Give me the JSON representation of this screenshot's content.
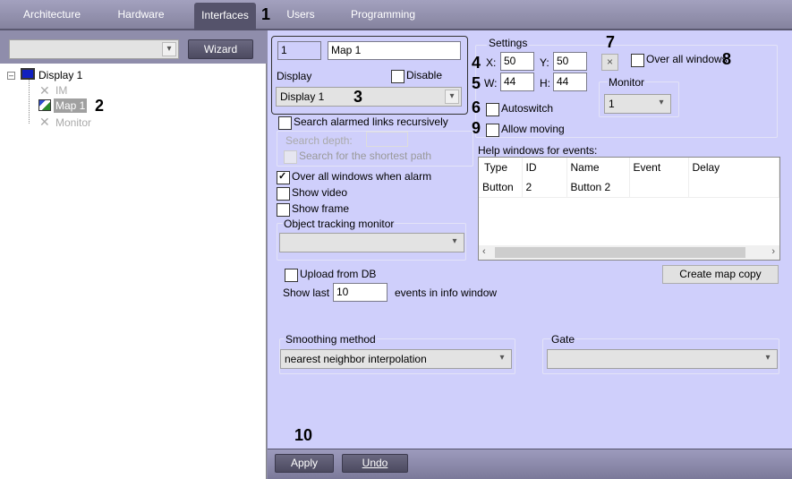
{
  "tabs": [
    {
      "label": "Architecture"
    },
    {
      "label": "Hardware"
    },
    {
      "label": "Interfaces",
      "active": true
    },
    {
      "label": "Users"
    },
    {
      "label": "Programming"
    }
  ],
  "callouts": [
    "1",
    "2",
    "3",
    "4",
    "5",
    "6",
    "7",
    "8",
    "9",
    "10"
  ],
  "left": {
    "filter_value": "",
    "wizard_label": "Wizard",
    "tree": [
      {
        "label": "Display 1",
        "icon": "monitor-icon"
      },
      {
        "label": "IM",
        "icon": "x-icon",
        "disabled": true
      },
      {
        "label": "Map 1",
        "icon": "map-icon",
        "selected": true
      },
      {
        "label": "Monitor",
        "icon": "x-icon",
        "disabled": true
      }
    ]
  },
  "object": {
    "id": "1",
    "name": "Map 1",
    "display_label": "Display",
    "disable_label": "Disable",
    "display_value": "Display 1"
  },
  "settings": {
    "title": "Settings",
    "x_label": "X:",
    "x": "50",
    "y_label": "Y:",
    "y": "50",
    "w_label": "W:",
    "w": "44",
    "h_label": "H:",
    "h": "44",
    "close_glyph": "×",
    "over_all_windows": "Over all windows",
    "monitor_label": "Monitor",
    "monitor_value": "1",
    "autoswitch": "Autoswitch",
    "allow_moving": "Allow moving"
  },
  "search": {
    "recursive": "Search alarmed links recursively",
    "depth_label": "Search depth:",
    "depth_value": "",
    "shortest": "Search for the shortest path"
  },
  "options": {
    "over_all_alarm": "Over all windows when alarm",
    "show_video": "Show video",
    "show_frame": "Show frame",
    "tracking_label": "Object tracking monitor",
    "tracking_value": ""
  },
  "help": {
    "title": "Help windows for events:",
    "columns": [
      "Type",
      "ID",
      "Name",
      "Event",
      "Delay"
    ],
    "rows": [
      [
        "Button",
        "2",
        "Button 2",
        "",
        ""
      ]
    ]
  },
  "create_copy": "Create map copy",
  "upload": "Upload from DB",
  "show_last": "Show last",
  "show_last_value": "10",
  "events_suffix": "events in info window",
  "smoothing": {
    "label": "Smoothing method",
    "value": "nearest neighbor interpolation"
  },
  "gate": {
    "label": "Gate",
    "value": ""
  },
  "footer": {
    "apply": "Apply",
    "undo": "Undo"
  }
}
